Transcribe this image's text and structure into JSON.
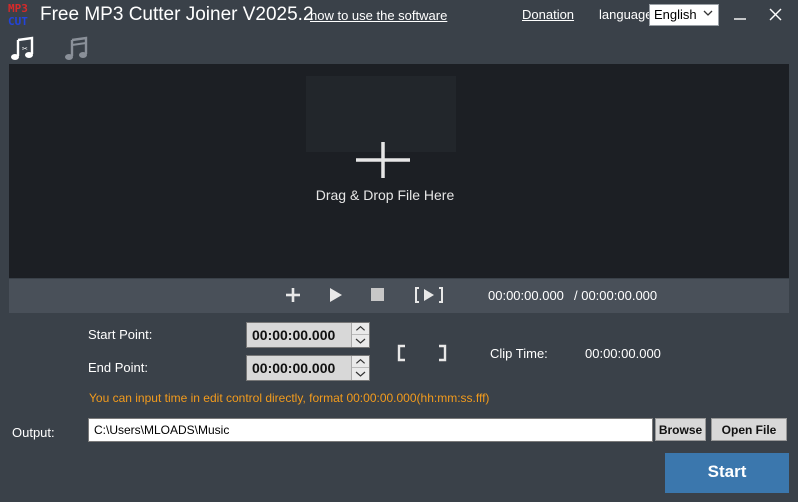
{
  "window": {
    "logo_top": "MP3",
    "logo_bottom": "CUT",
    "title": "Free MP3 Cutter Joiner V2025.2",
    "howto_link": "how to use the software",
    "donation_link": "Donation",
    "language_label": "language",
    "language_value": "English"
  },
  "icons": {
    "cut_mode": "music-cut-icon",
    "join_mode": "music-join-icon",
    "add": "plus-icon",
    "play": "play-icon",
    "stop": "stop-icon",
    "play_selection": "play-selection-icon",
    "set_start": "bracket-left-icon",
    "set_end": "bracket-right-icon",
    "minimize": "minimize-icon",
    "close": "close-icon"
  },
  "drop_area": {
    "text": "Drag & Drop File Here"
  },
  "transport": {
    "current_time": "00:00:00.000",
    "total_time": "/ 00:00:00.000"
  },
  "edit": {
    "start_label": "Start Point:",
    "start_value": "00:00:00.000",
    "end_label": "End Point:",
    "end_value": "00:00:00.000",
    "clip_label": "Clip Time:",
    "clip_value": "00:00:00.000",
    "hint": "You can input time in edit control directly, format 00:00:00.000(hh:mm:ss.fff)"
  },
  "output": {
    "label": "Output:",
    "path": "C:\\Users\\MLOADS\\Music",
    "browse_label": "Browse",
    "open_file_label": "Open File"
  },
  "start_button_label": "Start",
  "colors": {
    "background": "#3a4149",
    "drop_area": "#1c1f24",
    "transport_bar": "#495059",
    "hint": "#f29b1d",
    "start_button": "#3b77ad"
  }
}
